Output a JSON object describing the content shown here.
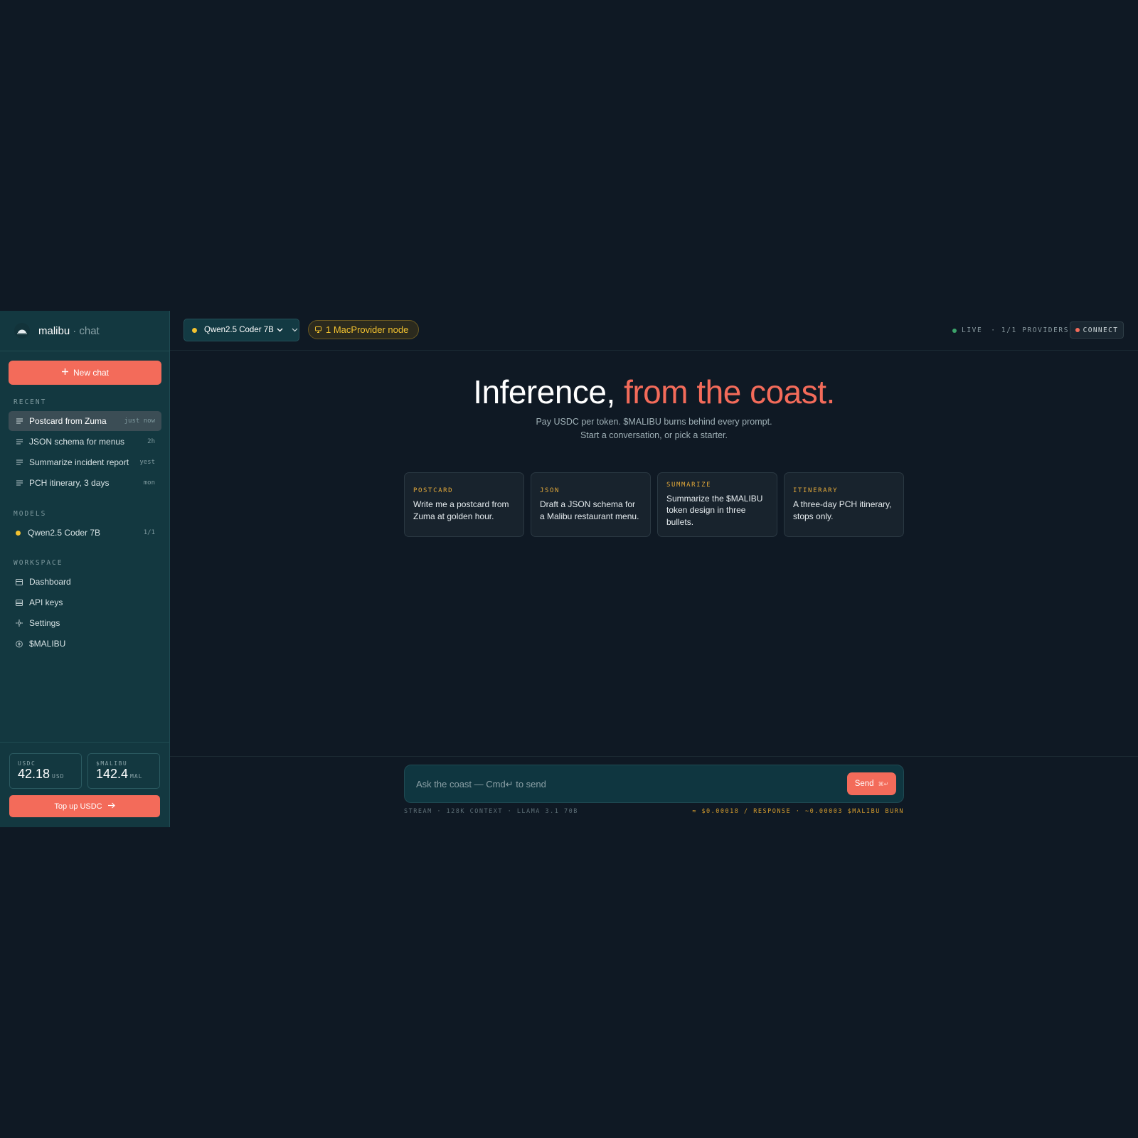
{
  "brand": {
    "name": "malibu",
    "suffix": "· chat"
  },
  "sidebar": {
    "new_chat_label": "New chat",
    "recent_label": "RECENT",
    "recent": [
      {
        "title": "Postcard from Zuma",
        "time": "just now",
        "active": true
      },
      {
        "title": "JSON schema for menus",
        "time": "2h"
      },
      {
        "title": "Summarize incident report",
        "time": "yest"
      },
      {
        "title": "PCH itinerary, 3 days",
        "time": "mon"
      }
    ],
    "models_label": "MODELS",
    "models": [
      {
        "name": "Qwen2.5 Coder 7B",
        "count": "1/1"
      }
    ],
    "workspace_label": "WORKSPACE",
    "workspace": [
      {
        "label": "Dashboard",
        "icon": "dashboard-icon"
      },
      {
        "label": "API keys",
        "icon": "api-keys-icon"
      },
      {
        "label": "Settings",
        "icon": "settings-icon"
      },
      {
        "label": "$MALIBU",
        "icon": "token-icon"
      }
    ],
    "balances": [
      {
        "title": "USDC",
        "value": "42.18",
        "unit": "USD"
      },
      {
        "title": "$MALIBU",
        "value": "142.4",
        "unit": "MAL"
      }
    ],
    "topup_label": "Top up USDC"
  },
  "topbar": {
    "model": "Qwen2.5 Coder 7B",
    "provider": "1 MacProvider node",
    "status_live": "LIVE",
    "status_providers": "· 1/1 PROVIDERS",
    "connect": "CONNECT"
  },
  "hero": {
    "title_main": "Inference,",
    "title_accent": "from the coast.",
    "sub_line1": "Pay USDC per token. $MALIBU burns behind every prompt.",
    "sub_line2": "Start a conversation, or pick a starter."
  },
  "starters": [
    {
      "tag": "POSTCARD",
      "text": "Write me a postcard from Zuma at golden hour."
    },
    {
      "tag": "JSON",
      "text": "Draft a JSON schema for a Malibu restaurant menu."
    },
    {
      "tag": "SUMMARIZE",
      "text": "Summarize the $MALIBU token design in three bullets."
    },
    {
      "tag": "ITINERARY",
      "text": "A three-day PCH itinerary, stops only."
    }
  ],
  "composer": {
    "placeholder": "Ask the coast — Cmd↵ to send",
    "send_label": "Send",
    "send_kbd": "⌘↵",
    "footer_left": "STREAM · 128K CONTEXT · LLAMA 3.1 70B",
    "footer_right": "≈ $0.00018 / RESPONSE · ~0.00003 $MALIBU BURN"
  },
  "colors": {
    "accent": "#f36b5a",
    "gold": "#f2c230",
    "sidebar": "#133840",
    "background": "#0f1924"
  }
}
